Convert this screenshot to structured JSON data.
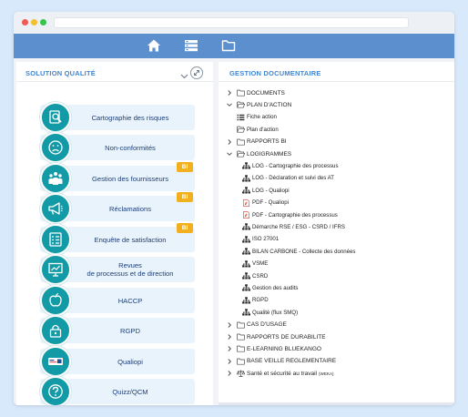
{
  "colors": {
    "background": "#d8e9fb",
    "navbar": "#5b8fce",
    "accent": "#3f86d4",
    "icon_circle": "#129aa6",
    "badge": "#f2b01e",
    "menu_bg": "#e9f3fb"
  },
  "navbar": {
    "icons": [
      "home-icon",
      "server-icon",
      "folder-icon"
    ]
  },
  "left_panel": {
    "title": "SOLUTION QUALITÉ",
    "items": [
      {
        "label": "Cartographie des risques",
        "icon": "search-report-icon",
        "badge": ""
      },
      {
        "label": "Non-conformités",
        "icon": "sad-face-icon",
        "badge": ""
      },
      {
        "label": "Gestion des fournisseurs",
        "icon": "people-group-icon",
        "badge": "BI"
      },
      {
        "label": "Réclamations",
        "icon": "megaphone-icon",
        "badge": "BI"
      },
      {
        "label": "Enquête de satisfaction",
        "icon": "survey-icon",
        "badge": "BI"
      },
      {
        "label": "Revues\nde processus et de direction",
        "icon": "presentation-icon",
        "badge": ""
      },
      {
        "label": "HACCP",
        "icon": "apple-icon",
        "badge": ""
      },
      {
        "label": "RGPD",
        "icon": "lock-icon",
        "badge": ""
      },
      {
        "label": "Qualiopi",
        "icon": "qualiopi-logo-icon",
        "badge": ""
      },
      {
        "label": "Quizz/QCM",
        "icon": "question-icon",
        "badge": ""
      }
    ]
  },
  "right_panel": {
    "title": "GESTION DOCUMENTAIRE",
    "tree": [
      {
        "label": "DOCUMENTS",
        "icon": "folder-icon",
        "chevron": "right",
        "level": 0
      },
      {
        "label": "PLAN D'ACTION",
        "icon": "folder-open-icon",
        "chevron": "down",
        "level": 0
      },
      {
        "label": "Fiche action",
        "icon": "list-icon",
        "chevron": "",
        "level": 1
      },
      {
        "label": "Plan d'action",
        "icon": "folder-open-icon",
        "chevron": "",
        "level": 1
      },
      {
        "label": "RAPPORTS BI",
        "icon": "folder-icon",
        "chevron": "right",
        "level": 0
      },
      {
        "label": "LOGIGRAMMES",
        "icon": "folder-open-icon",
        "chevron": "down",
        "level": 0
      },
      {
        "label": "LOG - Cartographie des processus",
        "icon": "hierarchy-icon",
        "chevron": "",
        "level": 2
      },
      {
        "label": "LOG - Déclaration et suivi des AT",
        "icon": "hierarchy-icon",
        "chevron": "",
        "level": 2
      },
      {
        "label": "LOG - Qualiopi",
        "icon": "hierarchy-icon",
        "chevron": "",
        "level": 2
      },
      {
        "label": "PDF - Qualiopi",
        "icon": "pdf-icon",
        "chevron": "",
        "level": 2
      },
      {
        "label": "PDF - Cartographie des processus",
        "icon": "pdf-icon",
        "chevron": "",
        "level": 2
      },
      {
        "label": "Démarche RSE / ESG - CSRD / IFRS",
        "icon": "hierarchy-icon",
        "chevron": "",
        "level": 2
      },
      {
        "label": "ISO 27001",
        "icon": "hierarchy-icon",
        "chevron": "",
        "level": 2
      },
      {
        "label": "BILAN CARBONE - Collecte des données",
        "icon": "hierarchy-icon",
        "chevron": "",
        "level": 2
      },
      {
        "label": "VSME",
        "icon": "hierarchy-icon",
        "chevron": "",
        "level": 2
      },
      {
        "label": "CSRD",
        "icon": "hierarchy-icon",
        "chevron": "",
        "level": 2
      },
      {
        "label": "Gestion des audits",
        "icon": "hierarchy-icon",
        "chevron": "",
        "level": 2
      },
      {
        "label": "RGPD",
        "icon": "hierarchy-icon",
        "chevron": "",
        "level": 2
      },
      {
        "label": "Qualité (flux SMQ)",
        "icon": "hierarchy-icon",
        "chevron": "",
        "level": 2
      },
      {
        "label": "CAS D'USAGE",
        "icon": "folder-icon",
        "chevron": "right",
        "level": 0
      },
      {
        "label": "RAPPORTS DE DURABILITE",
        "icon": "folder-icon",
        "chevron": "right",
        "level": 0
      },
      {
        "label": "E-LEARNING BLUEKANGO",
        "icon": "folder-icon",
        "chevron": "right",
        "level": 0
      },
      {
        "label": "BASE VEILLE REGLEMENTAIRE",
        "icon": "folder-icon",
        "chevron": "right",
        "level": 0
      },
      {
        "label": "Santé et sécurité au travail",
        "suffix": "(WEKA)",
        "icon": "scale-icon",
        "chevron": "right",
        "level": 0
      }
    ]
  }
}
